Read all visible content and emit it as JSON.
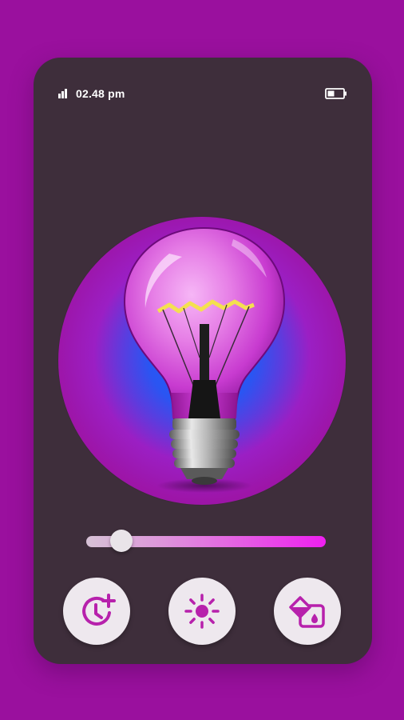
{
  "status_bar": {
    "time": "02.48 pm",
    "signal_icon": "signal-bars-icon",
    "battery_icon": "battery-icon"
  },
  "lamp": {
    "bulb_color": "#d24fe0",
    "glow_color": "#1f5cff",
    "halo_color": "#9d15a8"
  },
  "slider": {
    "value_percent": 10
  },
  "buttons": [
    {
      "name": "timer-add",
      "icon": "clock-plus-icon"
    },
    {
      "name": "brightness",
      "icon": "sun-icon"
    },
    {
      "name": "color-fill",
      "icon": "paint-bucket-icon"
    }
  ],
  "colors": {
    "background": "#9a109e",
    "panel": "#3e2e3b",
    "accent": "#c51fbf",
    "button_bg": "#eee8ee"
  }
}
